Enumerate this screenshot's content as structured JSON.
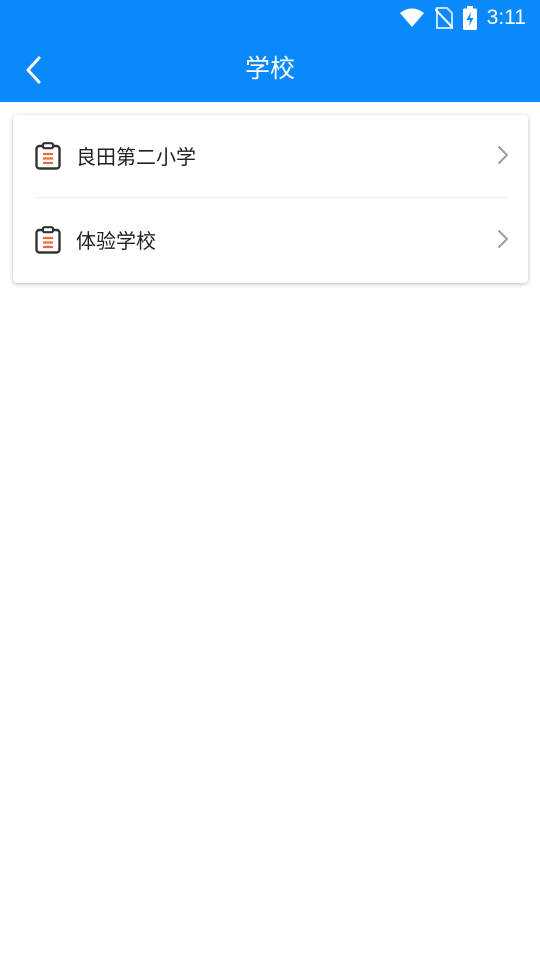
{
  "status_bar": {
    "time": "3:11",
    "icons": [
      "wifi-icon",
      "no-sim-icon",
      "battery-charging-icon"
    ]
  },
  "header": {
    "title": "学校",
    "back_icon": "chevron-left-icon"
  },
  "schools": [
    {
      "name": "良田第二小学",
      "icon": "clipboard-icon"
    },
    {
      "name": "体验学校",
      "icon": "clipboard-icon"
    }
  ],
  "colors": {
    "primary": "#0A89FD",
    "icon_accent": "#F06A35",
    "icon_outline": "#333333",
    "chevron": "#9E9E9E",
    "background": "#FFFFFF"
  }
}
